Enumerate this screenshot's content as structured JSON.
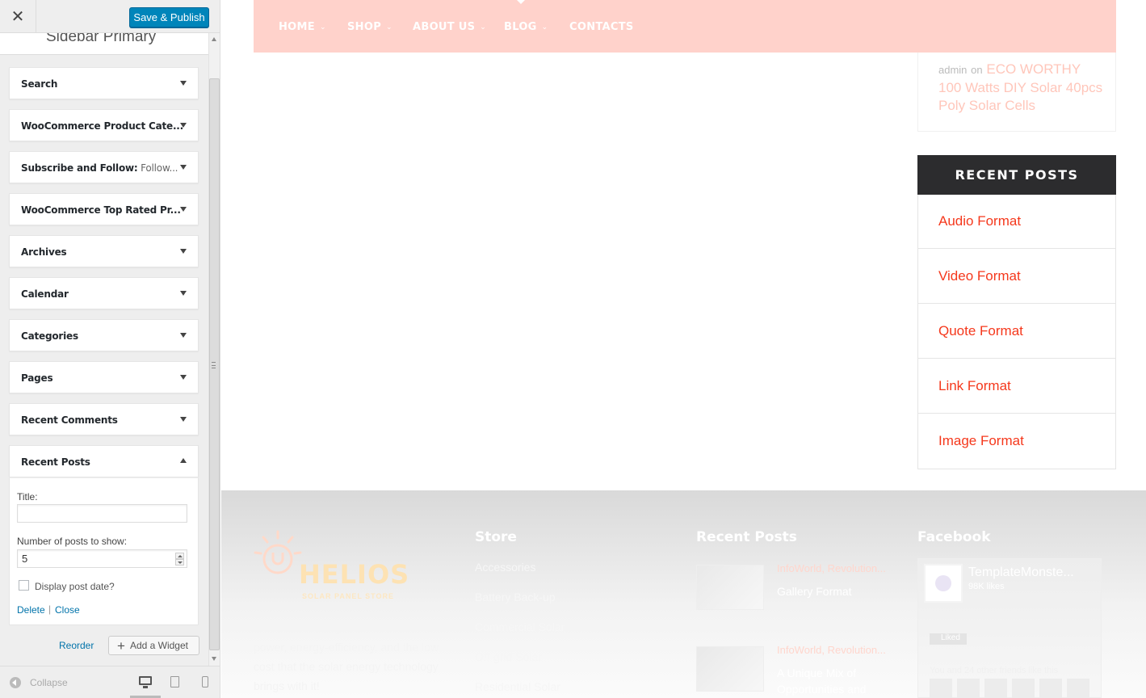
{
  "customizer": {
    "close_icon": "close-icon",
    "save_label": "Save & Publish",
    "section_title": "Sidebar Primary",
    "widgets": [
      {
        "title": "Search",
        "sub": ""
      },
      {
        "title": "WooCommerce Product Cate...",
        "sub": ""
      },
      {
        "title": "Subscribe and Follow:",
        "sub": " Follow..."
      },
      {
        "title": "WooCommerce Top Rated Pr...",
        "sub": ""
      },
      {
        "title": "Archives",
        "sub": ""
      },
      {
        "title": "Calendar",
        "sub": ""
      },
      {
        "title": "Categories",
        "sub": ""
      },
      {
        "title": "Pages",
        "sub": ""
      },
      {
        "title": "Recent Comments",
        "sub": ""
      },
      {
        "title": "Recent Posts",
        "sub": ""
      }
    ],
    "recent_posts_form": {
      "title_label": "Title:",
      "title_value": "",
      "number_label": "Number of posts to show:",
      "number_value": "5",
      "display_date_label": "Display post date?",
      "display_date_checked": false,
      "delete_label": "Delete",
      "separator": "|",
      "close_label": "Close"
    },
    "reorder_label": "Reorder",
    "add_widget_label": "Add a Widget",
    "collapse_label": "Collapse"
  },
  "preview": {
    "nav": [
      {
        "label": "HOME",
        "has_sub": true
      },
      {
        "label": "SHOP",
        "has_sub": true
      },
      {
        "label": "ABOUT US",
        "has_sub": true
      },
      {
        "label": "BLOG",
        "has_sub": true
      },
      {
        "label": "CONTACTS",
        "has_sub": false
      }
    ],
    "nav_color": "#ffd2cb",
    "recent_comment": {
      "author": "admin",
      "on": "on",
      "post": "ECO WORTHY 100 Watts DIY Solar 40pcs Poly Solar Cells"
    },
    "recent_posts_heading": "RECENT POSTS",
    "recent_posts": [
      "Audio Format",
      "Video Format",
      "Quote Format",
      "Link Format",
      "Image Format"
    ],
    "accent_color": "#f5381c"
  },
  "footer": {
    "logo_word": "HELIOS",
    "logo_sub": "SOLAR PANEL STORE",
    "intro": "We're introducing America to the power, energy-efficiency, and the low cost that the solar energy technology brings with it!",
    "store_heading": "Store",
    "store_links": [
      "Accessories",
      "Battery Back-up",
      "Commercial Solar",
      "Off-grid Solar",
      "Residential Solar"
    ],
    "recent_heading": "Recent Posts",
    "posts": [
      {
        "category": "InfoWorld, Revolution...",
        "title": "Gallery Format"
      },
      {
        "category": "InfoWorld, Revolution...",
        "title": "A Unique Mix of Opportunities and"
      }
    ],
    "facebook_heading": "Facebook",
    "facebook": {
      "page_name": "TemplateMonste...",
      "likes": "98K likes",
      "liked_label": "Liked",
      "friends_text": "You and 24 other friends like this"
    }
  }
}
